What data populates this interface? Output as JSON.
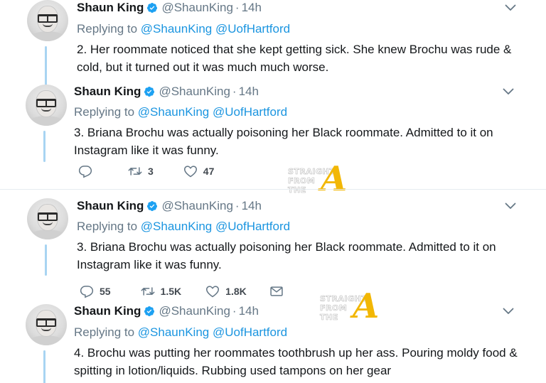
{
  "colors": {
    "link": "#1b95e0",
    "muted": "#657786",
    "verified": "#1da1f2",
    "thread": "#a8d4f2",
    "watermark_a": "#f2b705"
  },
  "watermark": {
    "line1": "STRAIGHT",
    "line2": "FROM",
    "line3": "THE",
    "letter": "A"
  },
  "tweets": [
    {
      "name": "Shaun King",
      "handle": "@ShaunKing",
      "separator": "·",
      "time": "14h",
      "replying_prefix": "Replying to",
      "mention1": "@ShaunKing",
      "mention2": "@UofHartford",
      "text": "2. Her roommate noticed that she kept getting sick. She knew Brochu was rude & cold, but it turned out it was much much worse."
    },
    {
      "name": "Shaun King",
      "handle": "@ShaunKing",
      "separator": "·",
      "time": "14h",
      "replying_prefix": "Replying to",
      "mention1": "@ShaunKing",
      "mention2": "@UofHartford",
      "text": "3. Briana Brochu was actually poisoning her Black roommate. Admitted to it on Instagram like it was funny.",
      "retweets": "3",
      "likes": "47"
    },
    {
      "name": "Shaun King",
      "handle": "@ShaunKing",
      "separator": "·",
      "time": "14h",
      "replying_prefix": "Replying to",
      "mention1": "@ShaunKing",
      "mention2": "@UofHartford",
      "text": "3. Briana Brochu was actually poisoning her Black roommate. Admitted to it on Instagram like it was funny.",
      "replies": "55",
      "retweets": "1.5K",
      "likes": "1.8K"
    },
    {
      "name": "Shaun King",
      "handle": "@ShaunKing",
      "separator": "·",
      "time": "14h",
      "replying_prefix": "Replying to",
      "mention1": "@ShaunKing",
      "mention2": "@UofHartford",
      "text": "4. Brochu was putting her roommates toothbrush up her ass. Pouring moldy food & spitting in lotion/liquids. Rubbing used tampons on her gear"
    }
  ]
}
